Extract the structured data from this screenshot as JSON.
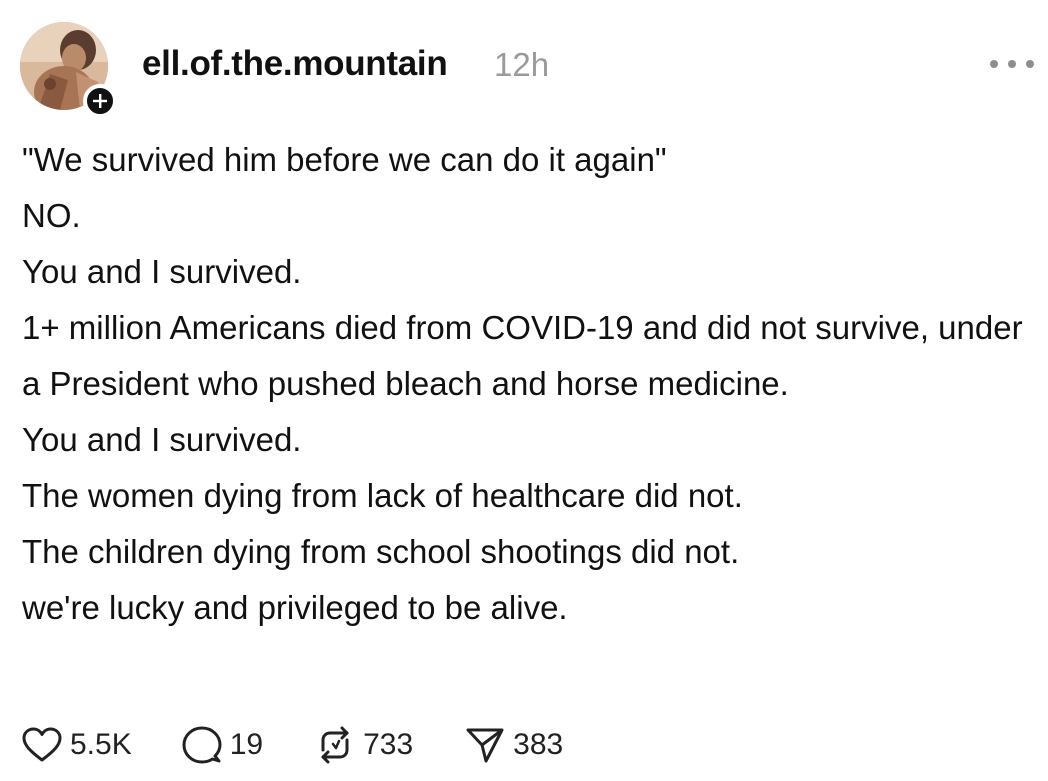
{
  "post": {
    "author": {
      "username": "ell.of.the.mountain",
      "avatar_icon": "profile-photo",
      "follow_icon": "plus-icon"
    },
    "timestamp": "12h",
    "more_icon": "ellipsis-icon",
    "lines": [
      "\"We survived him before we can do it again\"",
      "NO.",
      "You and I survived.",
      "1+ million Americans died from COVID-19 and did not survive, under a President who pushed bleach and horse medicine.",
      "You and I survived.",
      "The women dying from lack of healthcare did not.",
      "The children dying from school shootings did not.",
      "we're lucky and privileged to be alive."
    ],
    "actions": {
      "likes": "5.5K",
      "replies": "19",
      "reposts": "733",
      "shares": "383"
    },
    "colors": {
      "text": "#111111",
      "timestamp": "#9a9a9a",
      "icon": "#222222"
    }
  }
}
